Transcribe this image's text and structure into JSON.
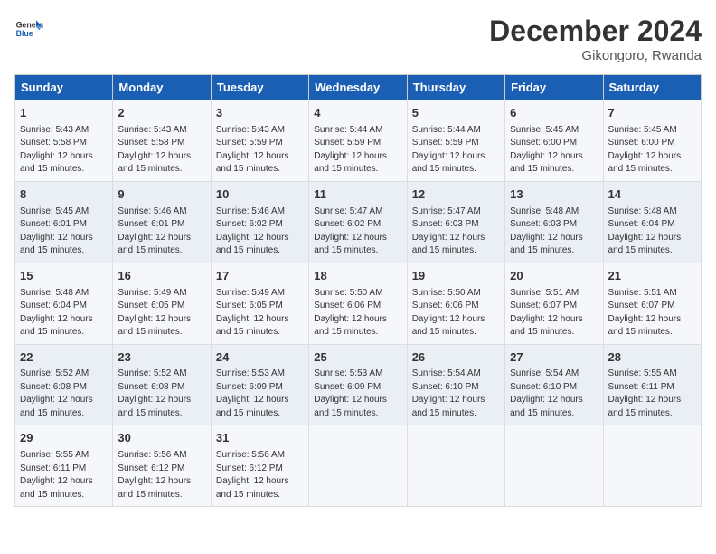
{
  "logo": {
    "text_general": "General",
    "text_blue": "Blue"
  },
  "header": {
    "month": "December 2024",
    "location": "Gikongoro, Rwanda"
  },
  "days_of_week": [
    "Sunday",
    "Monday",
    "Tuesday",
    "Wednesday",
    "Thursday",
    "Friday",
    "Saturday"
  ],
  "weeks": [
    [
      {
        "day": "1",
        "content": "Sunrise: 5:43 AM\nSunset: 5:58 PM\nDaylight: 12 hours\nand 15 minutes."
      },
      {
        "day": "2",
        "content": "Sunrise: 5:43 AM\nSunset: 5:58 PM\nDaylight: 12 hours\nand 15 minutes."
      },
      {
        "day": "3",
        "content": "Sunrise: 5:43 AM\nSunset: 5:59 PM\nDaylight: 12 hours\nand 15 minutes."
      },
      {
        "day": "4",
        "content": "Sunrise: 5:44 AM\nSunset: 5:59 PM\nDaylight: 12 hours\nand 15 minutes."
      },
      {
        "day": "5",
        "content": "Sunrise: 5:44 AM\nSunset: 5:59 PM\nDaylight: 12 hours\nand 15 minutes."
      },
      {
        "day": "6",
        "content": "Sunrise: 5:45 AM\nSunset: 6:00 PM\nDaylight: 12 hours\nand 15 minutes."
      },
      {
        "day": "7",
        "content": "Sunrise: 5:45 AM\nSunset: 6:00 PM\nDaylight: 12 hours\nand 15 minutes."
      }
    ],
    [
      {
        "day": "8",
        "content": "Sunrise: 5:45 AM\nSunset: 6:01 PM\nDaylight: 12 hours\nand 15 minutes."
      },
      {
        "day": "9",
        "content": "Sunrise: 5:46 AM\nSunset: 6:01 PM\nDaylight: 12 hours\nand 15 minutes."
      },
      {
        "day": "10",
        "content": "Sunrise: 5:46 AM\nSunset: 6:02 PM\nDaylight: 12 hours\nand 15 minutes."
      },
      {
        "day": "11",
        "content": "Sunrise: 5:47 AM\nSunset: 6:02 PM\nDaylight: 12 hours\nand 15 minutes."
      },
      {
        "day": "12",
        "content": "Sunrise: 5:47 AM\nSunset: 6:03 PM\nDaylight: 12 hours\nand 15 minutes."
      },
      {
        "day": "13",
        "content": "Sunrise: 5:48 AM\nSunset: 6:03 PM\nDaylight: 12 hours\nand 15 minutes."
      },
      {
        "day": "14",
        "content": "Sunrise: 5:48 AM\nSunset: 6:04 PM\nDaylight: 12 hours\nand 15 minutes."
      }
    ],
    [
      {
        "day": "15",
        "content": "Sunrise: 5:48 AM\nSunset: 6:04 PM\nDaylight: 12 hours\nand 15 minutes."
      },
      {
        "day": "16",
        "content": "Sunrise: 5:49 AM\nSunset: 6:05 PM\nDaylight: 12 hours\nand 15 minutes."
      },
      {
        "day": "17",
        "content": "Sunrise: 5:49 AM\nSunset: 6:05 PM\nDaylight: 12 hours\nand 15 minutes."
      },
      {
        "day": "18",
        "content": "Sunrise: 5:50 AM\nSunset: 6:06 PM\nDaylight: 12 hours\nand 15 minutes."
      },
      {
        "day": "19",
        "content": "Sunrise: 5:50 AM\nSunset: 6:06 PM\nDaylight: 12 hours\nand 15 minutes."
      },
      {
        "day": "20",
        "content": "Sunrise: 5:51 AM\nSunset: 6:07 PM\nDaylight: 12 hours\nand 15 minutes."
      },
      {
        "day": "21",
        "content": "Sunrise: 5:51 AM\nSunset: 6:07 PM\nDaylight: 12 hours\nand 15 minutes."
      }
    ],
    [
      {
        "day": "22",
        "content": "Sunrise: 5:52 AM\nSunset: 6:08 PM\nDaylight: 12 hours\nand 15 minutes."
      },
      {
        "day": "23",
        "content": "Sunrise: 5:52 AM\nSunset: 6:08 PM\nDaylight: 12 hours\nand 15 minutes."
      },
      {
        "day": "24",
        "content": "Sunrise: 5:53 AM\nSunset: 6:09 PM\nDaylight: 12 hours\nand 15 minutes."
      },
      {
        "day": "25",
        "content": "Sunrise: 5:53 AM\nSunset: 6:09 PM\nDaylight: 12 hours\nand 15 minutes."
      },
      {
        "day": "26",
        "content": "Sunrise: 5:54 AM\nSunset: 6:10 PM\nDaylight: 12 hours\nand 15 minutes."
      },
      {
        "day": "27",
        "content": "Sunrise: 5:54 AM\nSunset: 6:10 PM\nDaylight: 12 hours\nand 15 minutes."
      },
      {
        "day": "28",
        "content": "Sunrise: 5:55 AM\nSunset: 6:11 PM\nDaylight: 12 hours\nand 15 minutes."
      }
    ],
    [
      {
        "day": "29",
        "content": "Sunrise: 5:55 AM\nSunset: 6:11 PM\nDaylight: 12 hours\nand 15 minutes."
      },
      {
        "day": "30",
        "content": "Sunrise: 5:56 AM\nSunset: 6:12 PM\nDaylight: 12 hours\nand 15 minutes."
      },
      {
        "day": "31",
        "content": "Sunrise: 5:56 AM\nSunset: 6:12 PM\nDaylight: 12 hours\nand 15 minutes."
      },
      {
        "day": "",
        "content": ""
      },
      {
        "day": "",
        "content": ""
      },
      {
        "day": "",
        "content": ""
      },
      {
        "day": "",
        "content": ""
      }
    ]
  ]
}
